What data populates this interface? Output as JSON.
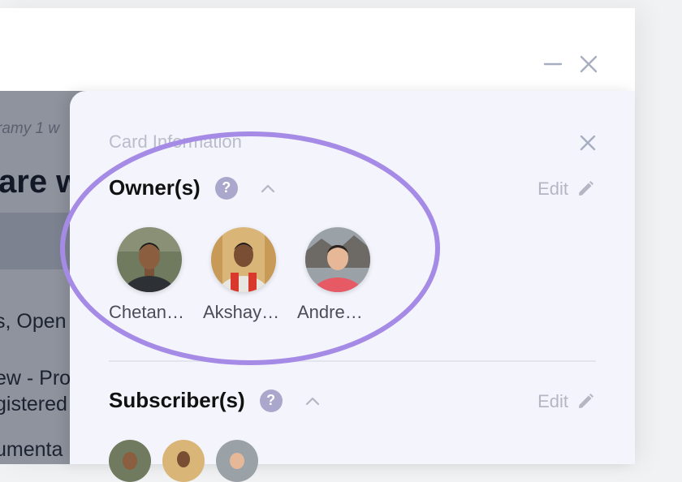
{
  "background": {
    "meta_text": "ramy 1 w",
    "title_fragment": "are w",
    "line1": "s, Open",
    "line2": "ew - Pro",
    "line3": "gistered",
    "line4": "umenta"
  },
  "window": {
    "minimize_icon": "minus-icon",
    "close_icon": "close-icon"
  },
  "panel": {
    "title": "Card Information",
    "owners": {
      "title": "Owner(s)",
      "help": "?",
      "edit_label": "Edit",
      "people": [
        {
          "name": "Chetan…"
        },
        {
          "name": "Akshay…"
        },
        {
          "name": "Andre…"
        }
      ]
    },
    "subscribers": {
      "title": "Subscriber(s)",
      "help": "?",
      "edit_label": "Edit"
    }
  },
  "colors": {
    "highlight": "#a58be6",
    "panel_bg": "#f4f4fc",
    "help_bg": "#a9a7cc"
  }
}
